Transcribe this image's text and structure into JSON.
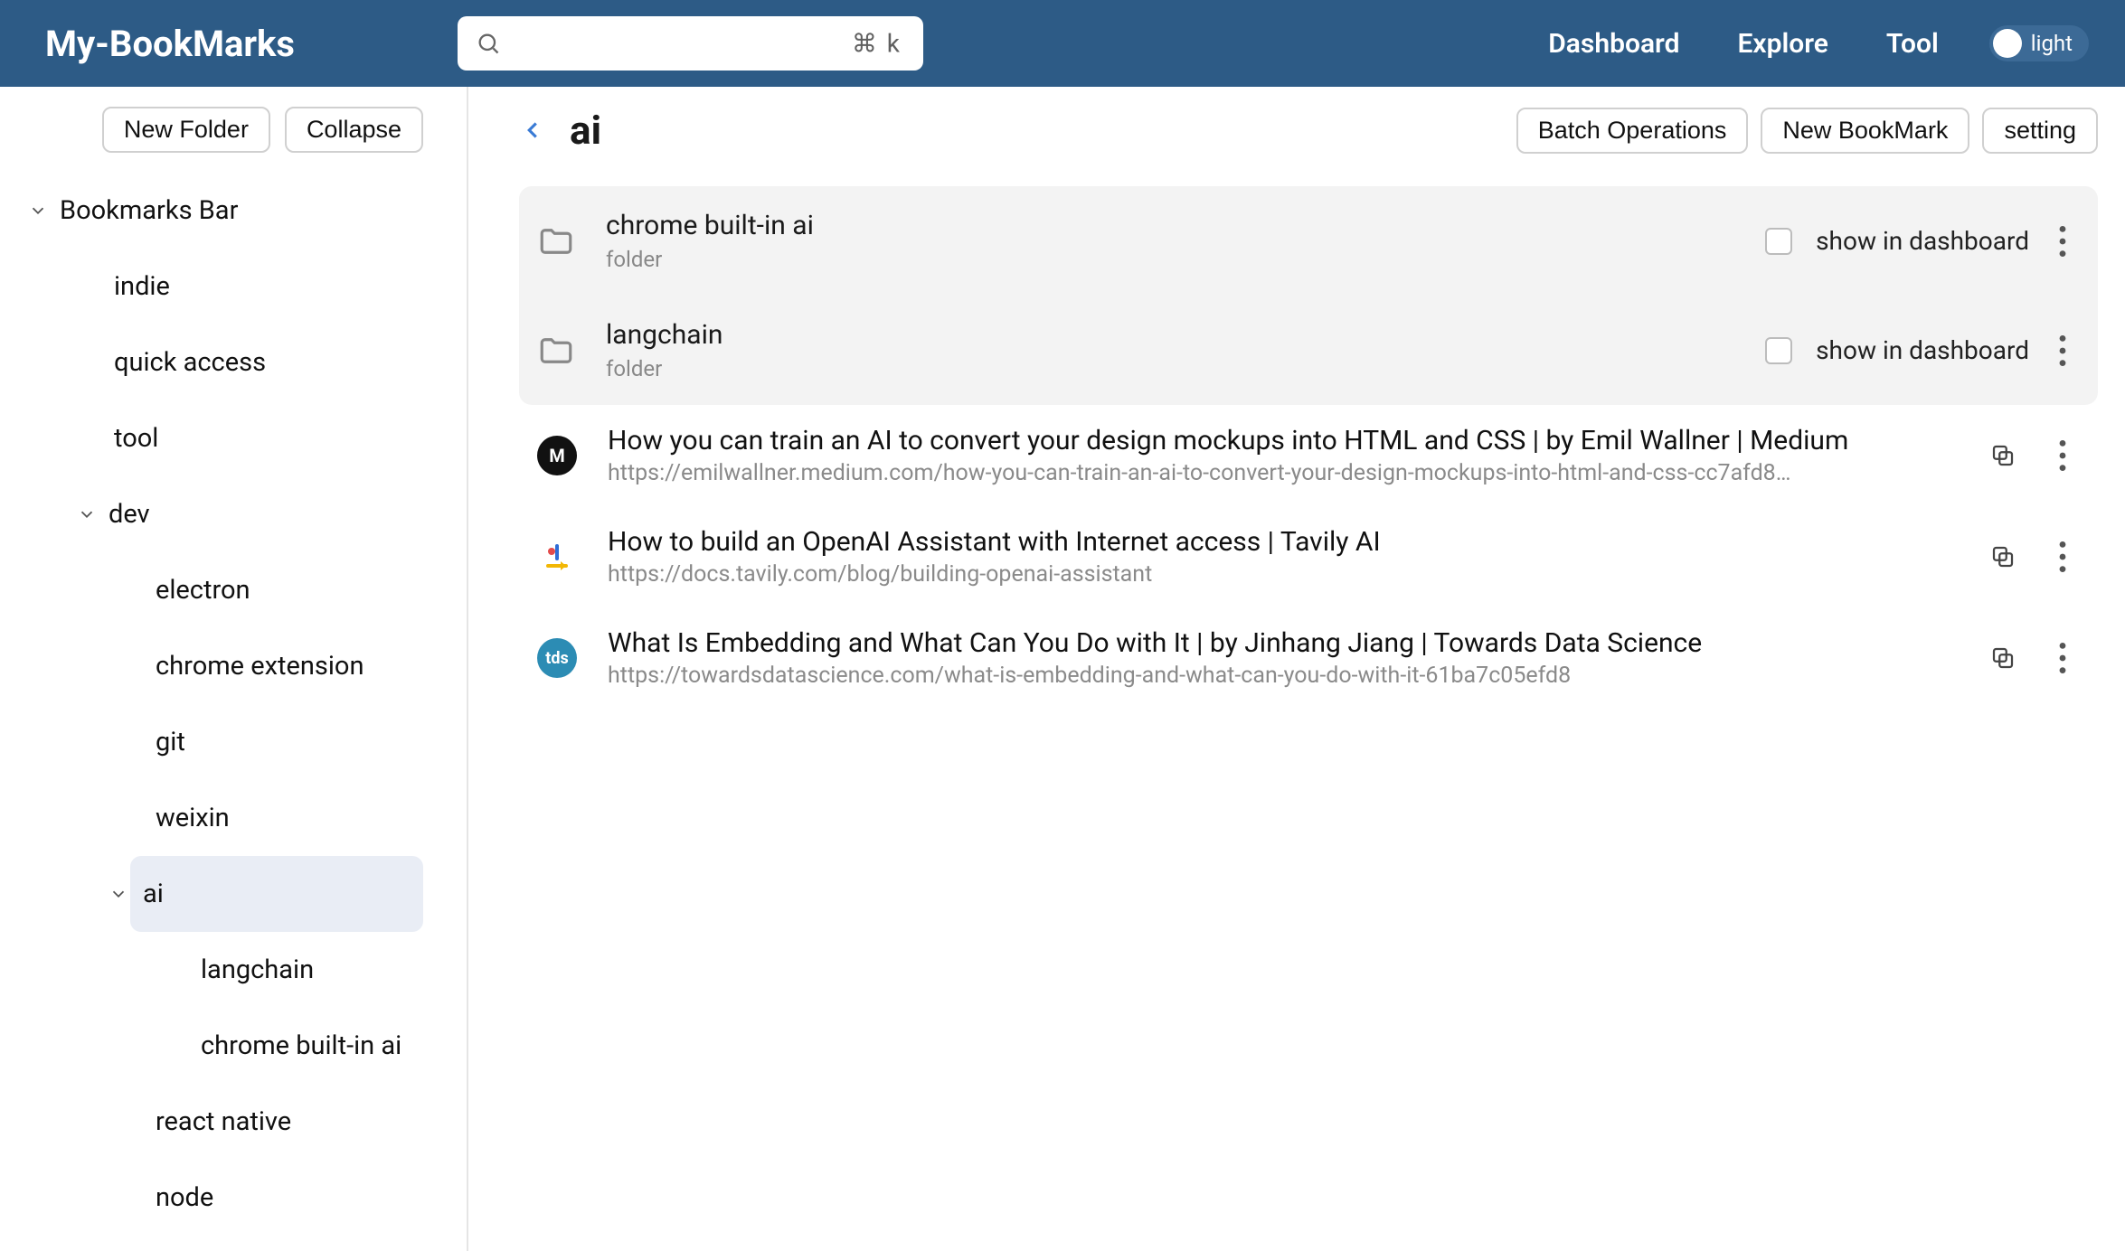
{
  "header": {
    "logo": "My-BookMarks",
    "search": {
      "placeholder": "",
      "shortcut": "⌘ k"
    },
    "nav": {
      "dashboard": "Dashboard",
      "explore": "Explore",
      "tool": "Tool"
    },
    "theme_label": "light"
  },
  "sidebar": {
    "new_folder": "New Folder",
    "collapse": "Collapse",
    "root_label": "Bookmarks Bar",
    "items_top": [
      {
        "label": "indie"
      },
      {
        "label": "quick access"
      },
      {
        "label": "tool"
      }
    ],
    "dev_label": "dev",
    "dev_children": [
      {
        "label": "electron"
      },
      {
        "label": "chrome extension"
      },
      {
        "label": "git"
      },
      {
        "label": "weixin"
      }
    ],
    "ai_label": "ai",
    "ai_children": [
      {
        "label": "langchain"
      },
      {
        "label": "chrome built-in ai"
      }
    ],
    "dev_tail": [
      {
        "label": "react native"
      },
      {
        "label": "node"
      }
    ]
  },
  "content": {
    "title": "ai",
    "batch": "Batch Operations",
    "new_bookmark": "New BookMark",
    "settings": "setting",
    "show_in_dashboard": "show in dashboard",
    "folder_type": "folder",
    "folders": [
      {
        "name": "chrome built-in ai"
      },
      {
        "name": "langchain"
      }
    ],
    "bookmarks": [
      {
        "title": "How you can train an AI to convert your design mockups into HTML and CSS | by Emil Wallner | Medium",
        "url": "https://emilwallner.medium.com/how-you-can-train-an-ai-to-convert-your-design-mockups-into-html-and-css-cc7afd8…",
        "fav_style": "fav-medium",
        "fav_text": "M"
      },
      {
        "title": "How to build an OpenAI Assistant with Internet access | Tavily AI",
        "url": "https://docs.tavily.com/blog/building-openai-assistant",
        "fav_style": "fav-tavily",
        "fav_text": ""
      },
      {
        "title": "What Is Embedding and What Can You Do with It | by Jinhang Jiang | Towards Data Science",
        "url": "https://towardsdatascience.com/what-is-embedding-and-what-can-you-do-with-it-61ba7c05efd8",
        "fav_style": "fav-tds",
        "fav_text": "tds"
      }
    ]
  }
}
